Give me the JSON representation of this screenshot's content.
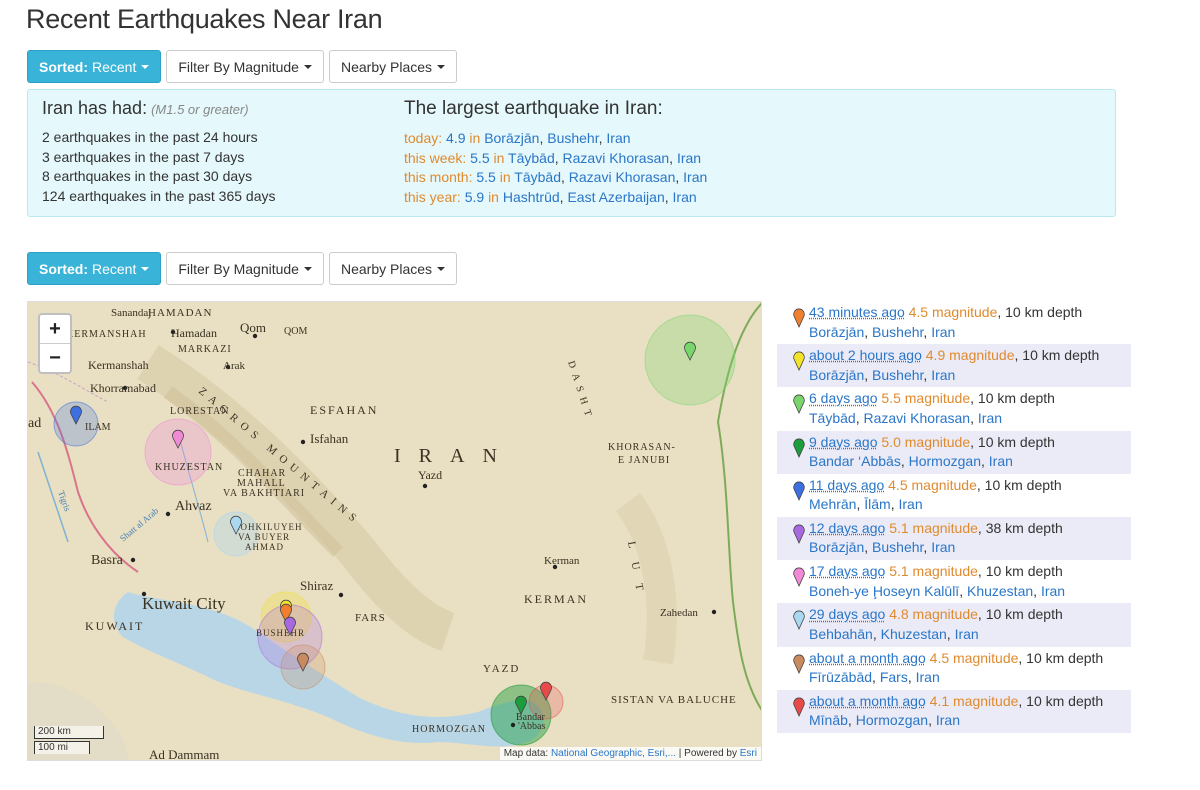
{
  "page": {
    "title": "Recent Earthquakes Near Iran"
  },
  "toolbar": {
    "sorted_bold": "Sorted:",
    "sorted_value": "Recent",
    "filter_label": "Filter By Magnitude",
    "nearby_label": "Nearby Places"
  },
  "summary": {
    "heading": "Iran has had:",
    "note": "(M1.5 or greater)",
    "counts": [
      "2 earthquakes in the past 24 hours",
      "3 earthquakes in the past 7 days",
      "8 earthquakes in the past 30 days",
      "124 earthquakes in the past 365 days"
    ],
    "largest_heading": "The largest earthquake in Iran:",
    "largest": [
      {
        "period": "today:",
        "mag": "4.9",
        "in": "in",
        "city": "Borāzjān",
        "region": "Bushehr",
        "country": "Iran"
      },
      {
        "period": "this week:",
        "mag": "5.5",
        "in": "in",
        "city": "Tāybād",
        "region": "Razavi Khorasan",
        "country": "Iran"
      },
      {
        "period": "this month:",
        "mag": "5.5",
        "in": "in",
        "city": "Tāybād",
        "region": "Razavi Khorasan",
        "country": "Iran"
      },
      {
        "period": "this year:",
        "mag": "5.9",
        "in": "in",
        "city": "Hashtrūd",
        "region": "East Azerbaijan",
        "country": "Iran"
      }
    ]
  },
  "map": {
    "zoom_in": "+",
    "zoom_out": "−",
    "scale_km": "200 km",
    "scale_mi": "100 mi",
    "attribution_prefix": "Map data:",
    "attribution_link": "National Geographic, Esri,...",
    "powered_by": "| Powered by",
    "powered_link": "Esri",
    "labels": {
      "sanandaj": "Sanandaj",
      "hamadan_prov": "HAMADAN",
      "kermanshah_prov": "KERMANSHAH",
      "hamadan": "Hamadan",
      "qom": "Qom",
      "qom_prov": "QOM",
      "markazi": "MARKAZI",
      "kermanshah": "Kermanshah",
      "arak": "Arak",
      "khorramabad": "Khorramabad",
      "lorestan": "LORESTAN",
      "esfahan_prov": "ESFAHAN",
      "ilam": "ILAM",
      "ad": "ad",
      "isfahan": "Isfahan",
      "iran": "IRAN",
      "khuzestan": "KHUZESTAN",
      "chahar": "CHAHAR",
      "mahall": "MAHALL",
      "bakhtiari": "VA BAKHTIARI",
      "yazd": "Yazd",
      "ahvaz": "Ahvaz",
      "kohkiluyeh": "KOHKILUYEH",
      "buyer": "VA BUYER",
      "ahmad": "AHMAD",
      "basra": "Basra",
      "kerman": "Kerman",
      "shiraz": "Shiraz",
      "kuwait_city": "Kuwait City",
      "fars": "FARS",
      "kerman_prov": "KERMAN",
      "zahedan": "Zahedan",
      "kuwait": "KUWAIT",
      "bushehr": "BUSHEHR",
      "yazd_prov": "YAZD",
      "sistan": "SISTAN VA BALUCHE",
      "bandar": "Bandar",
      "abbas": "'Abbas",
      "hormozgan": "HORMOZGAN",
      "ad_dammam": "Ad Dammam",
      "khorasan_e": "KHORASAN-",
      "janubi": "E JANUBI",
      "dasht": "DASHT",
      "lut": "LUT",
      "zagros": "ZAGROS MOUNTAINS",
      "tigris": "Tigris",
      "shatt": "Shatt al Arab"
    }
  },
  "quakes": [
    {
      "ago": "43 minutes ago",
      "mag": "4.5 magnitude",
      "depth": ", 10 km depth",
      "city": "Borāzjān",
      "region": "Bushehr",
      "country": "Iran",
      "color": "#f08030"
    },
    {
      "ago": "about 2 hours ago",
      "mag": "4.9 magnitude",
      "depth": ", 10 km depth",
      "city": "Borāzjān",
      "region": "Bushehr",
      "country": "Iran",
      "color": "#f2e22a"
    },
    {
      "ago": "6 days ago",
      "mag": "5.5 magnitude",
      "depth": ", 10 km depth",
      "city": "Tāybād",
      "region": "Razavi Khorasan",
      "country": "Iran",
      "color": "#79d66c"
    },
    {
      "ago": "9 days ago",
      "mag": "5.0 magnitude",
      "depth": ", 10 km depth",
      "city": "Bandar ‘Abbās",
      "region": "Hormozgan",
      "country": "Iran",
      "color": "#1c9c3a"
    },
    {
      "ago": "11 days ago",
      "mag": "4.5 magnitude",
      "depth": ", 10 km depth",
      "city": "Mehrān",
      "region": "Īlām",
      "country": "Iran",
      "color": "#3c6fe0"
    },
    {
      "ago": "12 days ago",
      "mag": "5.1 magnitude",
      "depth": ", 38 km depth",
      "city": "Borāzjān",
      "region": "Bushehr",
      "country": "Iran",
      "color": "#a868e0"
    },
    {
      "ago": "17 days ago",
      "mag": "5.1 magnitude",
      "depth": ", 10 km depth",
      "city": "Boneh-ye Ḩoseyn Kalūlī",
      "region": "Khuzestan",
      "country": "Iran",
      "color": "#f08ad6"
    },
    {
      "ago": "29 days ago",
      "mag": "4.8 magnitude",
      "depth": ", 10 km depth",
      "city": "Behbahān",
      "region": "Khuzestan",
      "country": "Iran",
      "color": "#a9d8f0"
    },
    {
      "ago": "about a month ago",
      "mag": "4.5 magnitude",
      "depth": ", 10 km depth",
      "city": "Fīrūzābād",
      "region": "Fars",
      "country": "Iran",
      "color": "#c98a60"
    },
    {
      "ago": "about a month ago",
      "mag": "4.1 magnitude",
      "depth": ", 10 km depth",
      "city": "Mīnāb",
      "region": "Hormozgan",
      "country": "Iran",
      "color": "#e84a4a"
    }
  ]
}
